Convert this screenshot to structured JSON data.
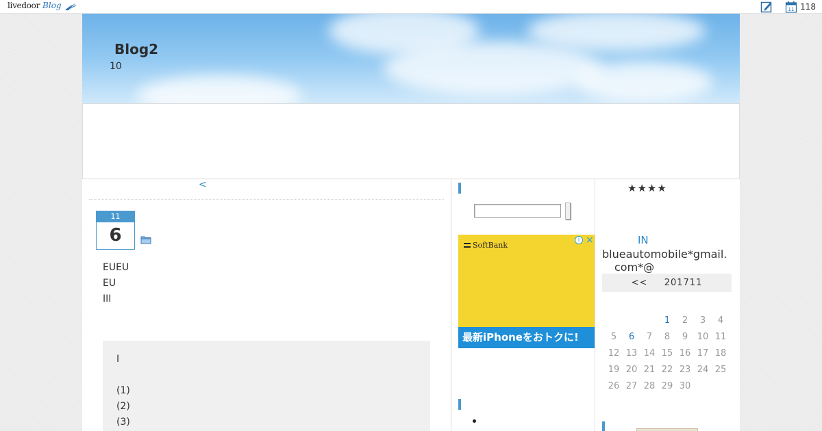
{
  "topbar": {
    "brand_livedoor": "livedoor",
    "brand_blog": "Blog",
    "icons": [
      "pen-square-icon",
      "calendar-icon"
    ],
    "calendar_day": "11",
    "count": "118"
  },
  "header": {
    "title": "Blog2",
    "description": "10",
    "colors": {
      "sky_top": "#6db2e9",
      "sky_bottom": "#d0e9fb"
    }
  },
  "main": {
    "prev_link": "<",
    "date": {
      "month": "11",
      "day": "6"
    },
    "lines": [
      "EUEU",
      "EU",
      "III"
    ],
    "quote": [
      "I",
      "",
      "(1)",
      "(2)",
      "(3)"
    ]
  },
  "mid": {
    "ad": {
      "brand": "SoftBank",
      "info": "i",
      "close": "×",
      "band_text": "最新iPhoneをおトクに!"
    }
  },
  "right": {
    "stars": "★★★★",
    "in_link": "IN",
    "mail_line1": "blueautomobile*gmail.",
    "mail_line2": "com*@",
    "calendar": {
      "prev": "<<",
      "month": "201711",
      "rows": [
        [
          "",
          "",
          "",
          "1",
          "2",
          "3",
          "4"
        ],
        [
          "5",
          "6",
          "7",
          "8",
          "9",
          "10",
          "11"
        ],
        [
          "12",
          "13",
          "14",
          "15",
          "16",
          "17",
          "18"
        ],
        [
          "19",
          "20",
          "21",
          "22",
          "23",
          "24",
          "25"
        ],
        [
          "26",
          "27",
          "28",
          "29",
          "30",
          "",
          ""
        ]
      ],
      "linked_days": [
        "1",
        "6"
      ]
    }
  },
  "colors": {
    "accent": "#4a9ad0",
    "link": "#2a8bc8",
    "ad_yellow": "#f4d530",
    "ad_blue": "#1e8fd8"
  }
}
